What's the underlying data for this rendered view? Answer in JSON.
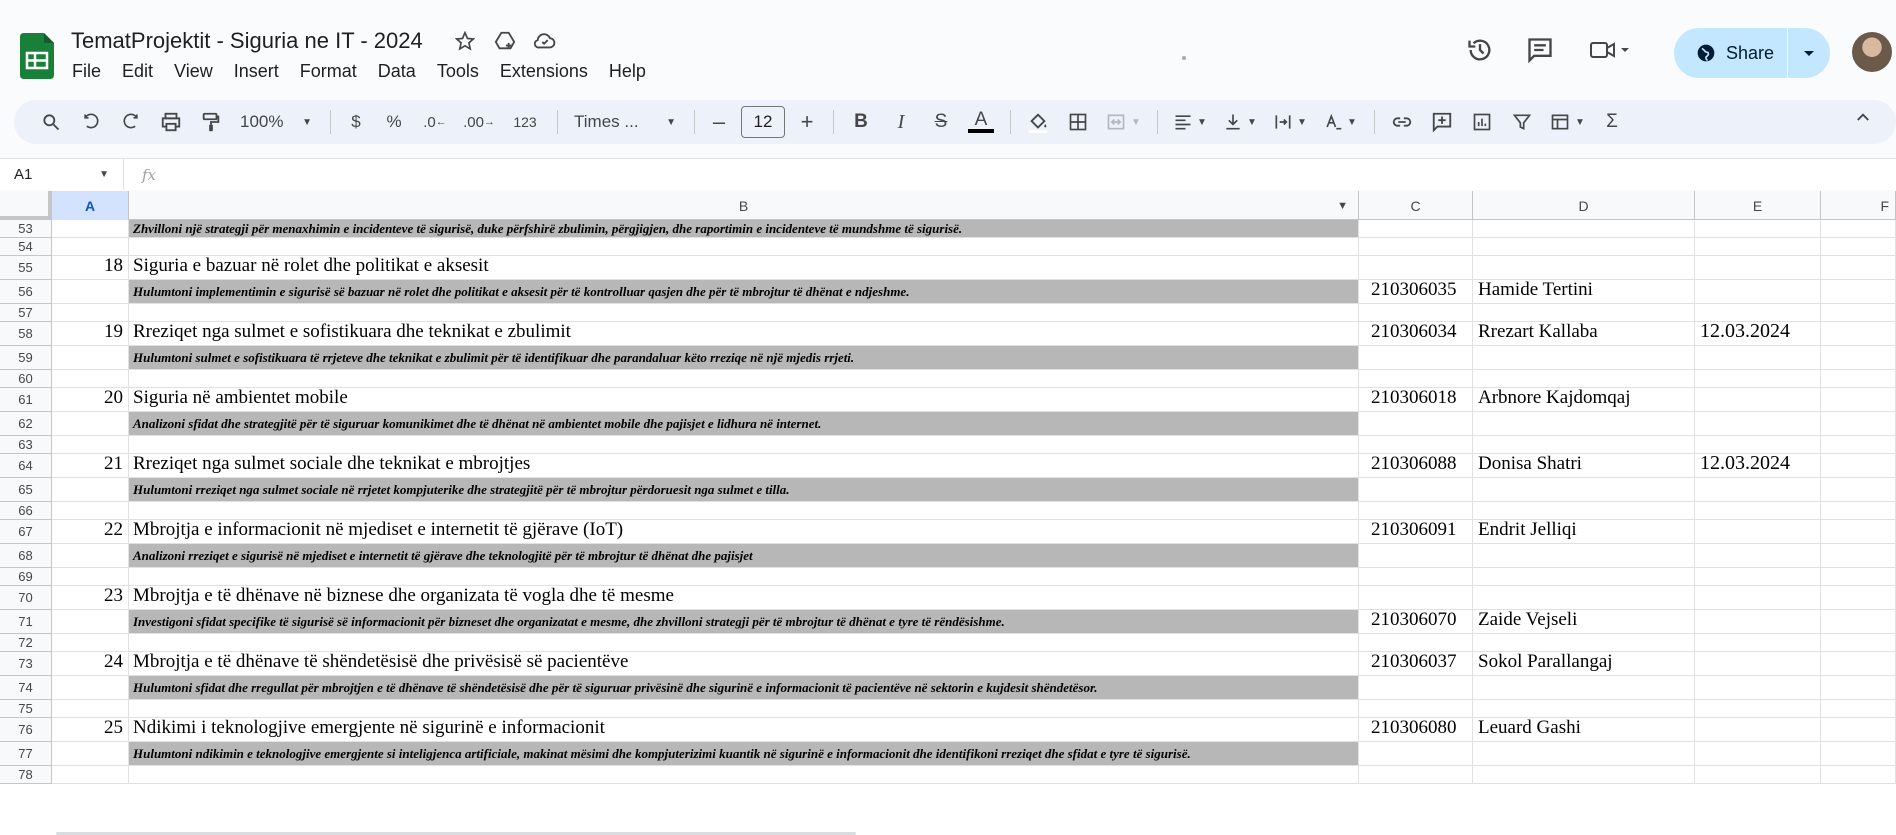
{
  "app": {
    "doc_title": "TematProjektit - Siguria ne IT - 2024",
    "menu": [
      "File",
      "Edit",
      "View",
      "Insert",
      "Format",
      "Data",
      "Tools",
      "Extensions",
      "Help"
    ],
    "share_label": "Share"
  },
  "toolbar": {
    "zoom": "100%",
    "currency": "$",
    "percent": "%",
    "dec_decrease": ".0",
    "dec_increase": ".00",
    "number_format": "123",
    "font": "Times ...",
    "font_size": "12",
    "minus": "–",
    "plus": "+",
    "bold": "B",
    "italic": "I",
    "strike": "S",
    "text_color": "A",
    "sigma": "Σ"
  },
  "formula_bar": {
    "name_box": "A1",
    "fx": "fx"
  },
  "columns": [
    "A",
    "B",
    "C",
    "D",
    "E",
    "F"
  ],
  "rows": [
    {
      "n": "53",
      "a": "",
      "b": "Zhvilloni një strategji për menaxhimin e incidenteve të sigurisë, duke përfshirë zbulimin, përgjigjen, dhe raportimin e incidenteve të mundshme të sigurisë.",
      "desc": true,
      "c": "",
      "d": "",
      "e": ""
    },
    {
      "n": "54",
      "a": "",
      "b": "",
      "desc": false,
      "c": "",
      "d": "",
      "e": ""
    },
    {
      "n": "55",
      "a": "18",
      "b": "Siguria e bazuar në rolet dhe politikat e aksesit",
      "desc": false,
      "c": "",
      "d": "",
      "e": ""
    },
    {
      "n": "56",
      "a": "",
      "b": "Hulumtoni implementimin e sigurisë së bazuar në rolet dhe politikat e aksesit për të kontrolluar qasjen dhe për të mbrojtur të dhënat e ndjeshme.",
      "desc": true,
      "c": "210306035",
      "d": "Hamide Tertini",
      "e": ""
    },
    {
      "n": "57",
      "a": "",
      "b": "",
      "desc": false,
      "c": "",
      "d": "",
      "e": ""
    },
    {
      "n": "58",
      "a": "19",
      "b": "Rreziqet nga sulmet e sofistikuara dhe teknikat e zbulimit",
      "desc": false,
      "c": "210306034",
      "d": "Rrezart Kallaba",
      "e": "12.03.2024"
    },
    {
      "n": "59",
      "a": "",
      "b": "Hulumtoni sulmet e sofistikuara të rrjeteve dhe teknikat e zbulimit për të identifikuar dhe parandaluar këto rreziqe në një mjedis rrjeti.",
      "desc": true,
      "c": "",
      "d": "",
      "e": ""
    },
    {
      "n": "60",
      "a": "",
      "b": "",
      "desc": false,
      "c": "",
      "d": "",
      "e": ""
    },
    {
      "n": "61",
      "a": "20",
      "b": "Siguria në ambientet mobile",
      "desc": false,
      "c": "210306018",
      "d": "Arbnore Kajdomqaj",
      "e": ""
    },
    {
      "n": "62",
      "a": "",
      "b": "Analizoni sfidat dhe strategjitë për të siguruar komunikimet dhe të dhënat në ambientet mobile dhe pajisjet e lidhura në internet.",
      "desc": true,
      "c": "",
      "d": "",
      "e": ""
    },
    {
      "n": "63",
      "a": "",
      "b": "",
      "desc": false,
      "c": "",
      "d": "",
      "e": ""
    },
    {
      "n": "64",
      "a": "21",
      "b": "Rreziqet nga sulmet sociale dhe teknikat e mbrojtjes",
      "desc": false,
      "c": "210306088",
      "d": "Donisa Shatri",
      "e": "12.03.2024"
    },
    {
      "n": "65",
      "a": "",
      "b": "Hulumtoni rreziqet nga sulmet sociale në rrjetet kompjuterike dhe strategjitë për të mbrojtur përdoruesit nga sulmet e tilla.",
      "desc": true,
      "c": "",
      "d": "",
      "e": ""
    },
    {
      "n": "66",
      "a": "",
      "b": "",
      "desc": false,
      "c": "",
      "d": "",
      "e": ""
    },
    {
      "n": "67",
      "a": "22",
      "b": "Mbrojtja e informacionit në mjediset e internetit të gjërave (IoT)",
      "desc": false,
      "c": "210306091",
      "d": "Endrit Jelliqi",
      "e": ""
    },
    {
      "n": "68",
      "a": "",
      "b": "Analizoni rreziqet e sigurisë në mjediset e internetit të gjërave dhe teknologjitë për të mbrojtur të dhënat dhe pajisjet",
      "desc": true,
      "c": "",
      "d": "",
      "e": ""
    },
    {
      "n": "69",
      "a": "",
      "b": "",
      "desc": false,
      "c": "",
      "d": "",
      "e": ""
    },
    {
      "n": "70",
      "a": "23",
      "b": "Mbrojtja e të dhënave në biznese dhe organizata të vogla dhe të mesme",
      "desc": false,
      "c": "",
      "d": "",
      "e": ""
    },
    {
      "n": "71",
      "a": "",
      "b": "Investigoni sfidat specifike të sigurisë së informacionit për bizneset dhe organizatat e mesme, dhe zhvilloni strategji për të mbrojtur të dhënat e tyre të rëndësishme.",
      "desc": true,
      "c": "210306070",
      "d": "Zaide Vejseli",
      "e": ""
    },
    {
      "n": "72",
      "a": "",
      "b": "",
      "desc": false,
      "c": "",
      "d": "",
      "e": ""
    },
    {
      "n": "73",
      "a": "24",
      "b": "Mbrojtja e të dhënave të shëndetësisë dhe privësisë së pacientëve",
      "desc": false,
      "c": "210306037",
      "d": "Sokol Parallangaj",
      "e": ""
    },
    {
      "n": "74",
      "a": "",
      "b": "Hulumtoni sfidat dhe rregullat për mbrojtjen e të dhënave të shëndetësisë dhe për të siguruar privësinë dhe sigurinë e informacionit të pacientëve në sektorin e kujdesit shëndetësor.",
      "desc": true,
      "c": "",
      "d": "",
      "e": ""
    },
    {
      "n": "75",
      "a": "",
      "b": "",
      "desc": false,
      "c": "",
      "d": "",
      "e": ""
    },
    {
      "n": "76",
      "a": "25",
      "b": "Ndikimi i teknologjive emergjente në sigurinë e informacionit",
      "desc": false,
      "c": "210306080",
      "d": "Leuard Gashi",
      "e": ""
    },
    {
      "n": "77",
      "a": "",
      "b": "Hulumtoni ndikimin e teknologjive emergjente si inteligjenca artificiale, makinat mësimi dhe kompjuterizimi kuantik në sigurinë e informacionit dhe identifikoni rreziqet dhe sfidat e tyre të sigurisë.",
      "desc": true,
      "c": "",
      "d": "",
      "e": ""
    },
    {
      "n": "78",
      "a": "",
      "b": "",
      "desc": false,
      "c": "",
      "d": "",
      "e": ""
    }
  ],
  "colors": {
    "accent": "#0b57d0",
    "share_bg": "#c2e7ff",
    "desc_fill": "#b7b7b7",
    "sheets_green": "#188038"
  }
}
